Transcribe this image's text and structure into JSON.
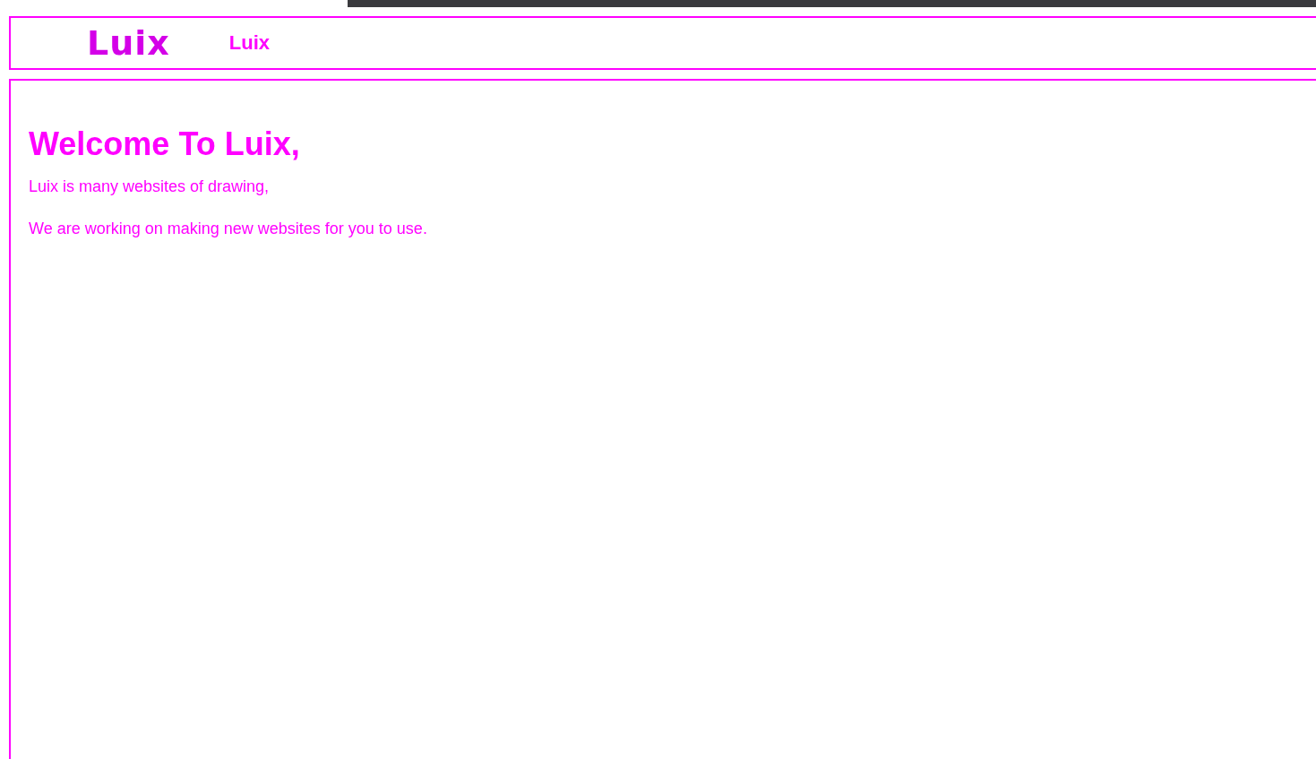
{
  "header": {
    "logo": "Luix",
    "nav_link": "Luix"
  },
  "main": {
    "heading": "Welcome To Luix,",
    "paragraphs": [
      "Luix is many websites of drawing,",
      "We are working on making new websites for you to use."
    ]
  }
}
